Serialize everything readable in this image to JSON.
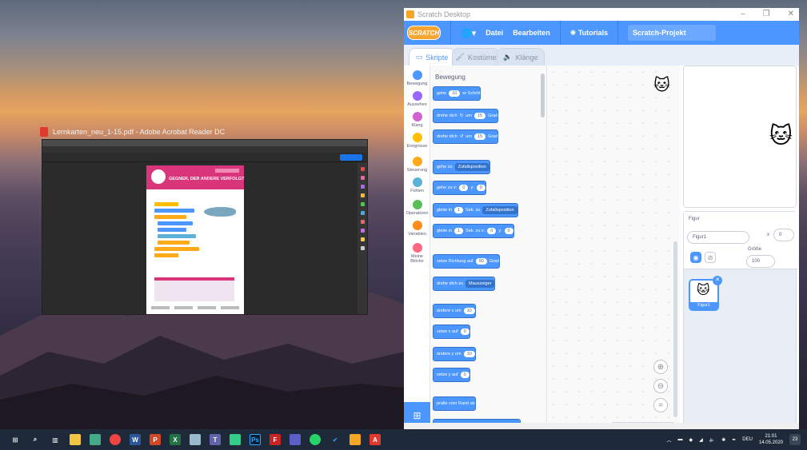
{
  "acrobat": {
    "title": "Lernkarten_neu_1-15.pdf - Adobe Acrobat Reader DC",
    "page_title": "GEGNER, DER ANDERE VERFOLGT"
  },
  "scratch": {
    "window_title": "Scratch Desktop",
    "logo": "SCRATCH",
    "menu": {
      "file": "Datei",
      "edit": "Bearbeiten",
      "tutorials": "Tutorials",
      "project_name": "Scratch-Projekt"
    },
    "tabs": {
      "code": "Skripte",
      "costumes": "Kostüme",
      "sounds": "Klänge"
    },
    "categories": [
      "Bewegung",
      "Aussehen",
      "Klang",
      "Ereignisse",
      "Steuerung",
      "Fühlen",
      "Operatoren",
      "Variablen",
      "Meine Blöcke"
    ],
    "category_colors": [
      "#4c97ff",
      "#9966ff",
      "#cf63cf",
      "#ffbf00",
      "#ffab19",
      "#5cb1d6",
      "#59c059",
      "#ff8c1a",
      "#ff6680"
    ],
    "palette_heading": "Bewegung",
    "blocks": {
      "move": {
        "pre": "gehe",
        "val": "10",
        "post": "er Schritt"
      },
      "turn_right": {
        "pre": "drehe dich",
        "mid": "um",
        "val": "15",
        "post": "Grad"
      },
      "turn_left": {
        "pre": "drehe dich",
        "mid": "um",
        "val": "15",
        "post": "Grad"
      },
      "goto": {
        "pre": "gehe zu",
        "dd": "Zufallsposition"
      },
      "goto_xy": {
        "pre": "gehe zu x:",
        "x": "0",
        "ymid": "y:",
        "y": "0"
      },
      "glide": {
        "pre": "gleite in",
        "val": "1",
        "mid": "Sek. zu",
        "dd": "Zufallsposition"
      },
      "glide_xy": {
        "pre": "gleite in",
        "val": "1",
        "mid": "Sek. zu x:",
        "x": "0",
        "ymid": "y:",
        "y": "0"
      },
      "point_dir": {
        "pre": "setze Richtung auf",
        "val": "90",
        "post": "Grad"
      },
      "point_towards": {
        "pre": "drehe dich zu",
        "dd": "Mauszeiger"
      },
      "change_x": {
        "pre": "ändere x um",
        "val": "10"
      },
      "set_x": {
        "pre": "setze x auf",
        "val": "0"
      },
      "change_y": {
        "pre": "ändere y um",
        "val": "10"
      },
      "set_y": {
        "pre": "setze y auf",
        "val": "0"
      },
      "bounce": {
        "pre": "pralle vom Rand ab"
      }
    },
    "sprite_info": {
      "sprite_label": "Figur",
      "sprite_name": "Figur1",
      "x_label": "x",
      "x_value": "0",
      "size_label": "Größe",
      "size_value": "100"
    },
    "sprite_thumb_name": "Figur1",
    "colors": {
      "primary": "#4c97ff",
      "menu": "#4c97ff",
      "flag": "#45a736",
      "stop": "#ec5959"
    }
  },
  "taskbar": {
    "language": "DEU",
    "time": "21:01",
    "date": "14.05.2020",
    "notifications": "23"
  }
}
